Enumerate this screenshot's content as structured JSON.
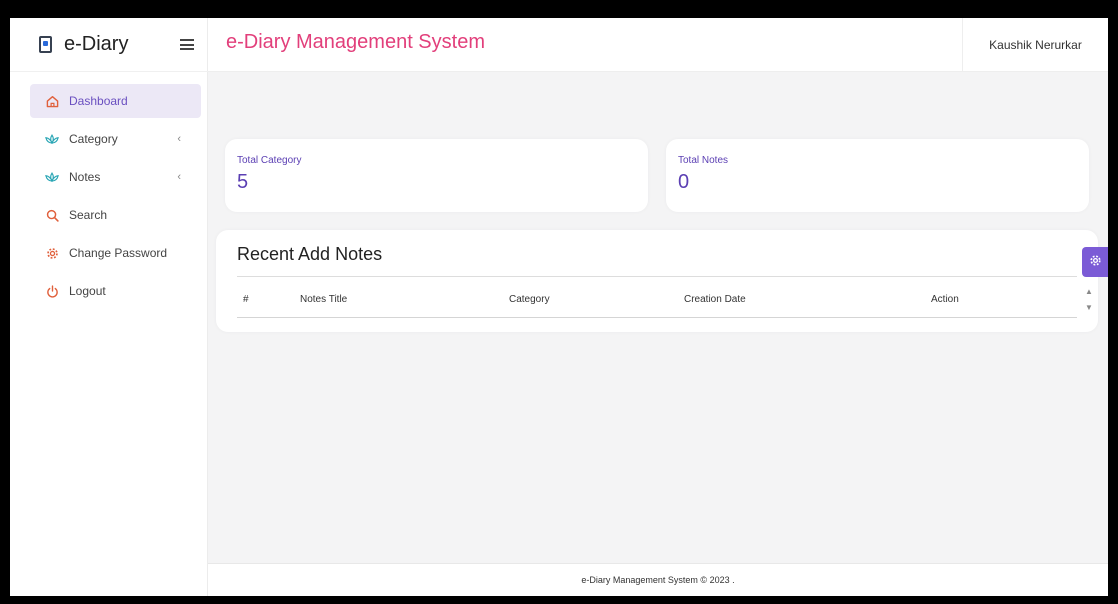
{
  "sidebar": {
    "brand": "e-Diary",
    "items": [
      {
        "label": "Dashboard",
        "icon": "home-icon",
        "active": true
      },
      {
        "label": "Category",
        "icon": "lotus-icon",
        "has_submenu": true
      },
      {
        "label": "Notes",
        "icon": "lotus-icon",
        "has_submenu": true
      },
      {
        "label": "Search",
        "icon": "search-icon"
      },
      {
        "label": "Change Password",
        "icon": "gear-icon"
      },
      {
        "label": "Logout",
        "icon": "power-icon"
      }
    ]
  },
  "header": {
    "title": "e-Diary Management System",
    "user": "Kaushik Nerurkar"
  },
  "stats": [
    {
      "label": "Total Category",
      "value": "5"
    },
    {
      "label": "Total Notes",
      "value": "0"
    }
  ],
  "recent": {
    "title": "Recent Add Notes",
    "columns": [
      "#",
      "Notes Title",
      "Category",
      "Creation Date",
      "Action"
    ]
  },
  "footer": {
    "text": "e-Diary Management System © 2023 ."
  },
  "colors": {
    "accent": "#6a4fc0",
    "title_pink": "#e23f7b",
    "settings_button": "#7b5bd6"
  }
}
